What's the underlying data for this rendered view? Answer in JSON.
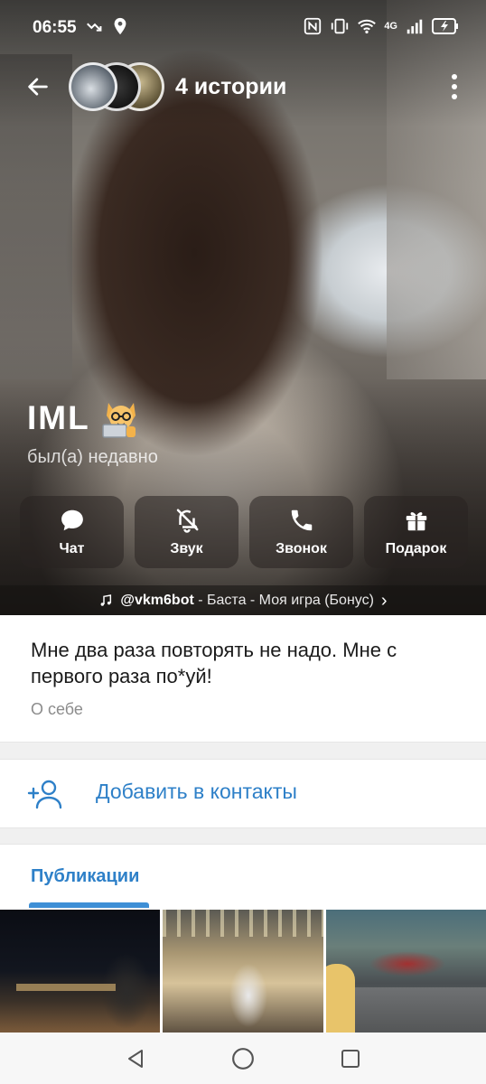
{
  "status_bar": {
    "time": "06:55",
    "network": "4G",
    "icons": [
      "missed-call-icon",
      "location-icon",
      "nfc-icon",
      "vibrate-icon",
      "wifi-icon",
      "signal-icon",
      "battery-charging-icon"
    ]
  },
  "app_bar": {
    "back_icon": "arrow-left-icon",
    "stories_title": "4 истории",
    "more_icon": "more-vertical-icon"
  },
  "profile": {
    "name": "IML",
    "name_emoji": "cat-laptop-emoji",
    "status": "был(а) недавно"
  },
  "actions": [
    {
      "label": "Чат",
      "icon": "chat-bubble-icon"
    },
    {
      "label": "Звук",
      "icon": "bell-off-icon"
    },
    {
      "label": "Звонок",
      "icon": "phone-icon"
    },
    {
      "label": "Подарок",
      "icon": "gift-icon"
    }
  ],
  "music": {
    "icon": "music-note-icon",
    "bot": "@vkm6bot",
    "separator": " - ",
    "track": "Баста - Моя игра (Бонус)",
    "chevron": "›"
  },
  "bio": {
    "text": "Мне два раза повторять не надо. Мне с первого раза по*уй!",
    "caption": "О себе"
  },
  "add_contact": {
    "icon": "add-person-icon",
    "label": "Добавить в контакты"
  },
  "publications": {
    "tab_label": "Публикации",
    "items": [
      "night-riverside-photo",
      "lit-building-photo",
      "street-motorbikes-photo"
    ]
  },
  "nav": {
    "icons": [
      "back-triangle-icon",
      "home-circle-icon",
      "recents-square-icon"
    ]
  },
  "colors": {
    "accent": "#2e80c8",
    "underline": "#3e8fd6",
    "muted_text": "#8c8c8c",
    "separator": "#f0f0f0"
  }
}
